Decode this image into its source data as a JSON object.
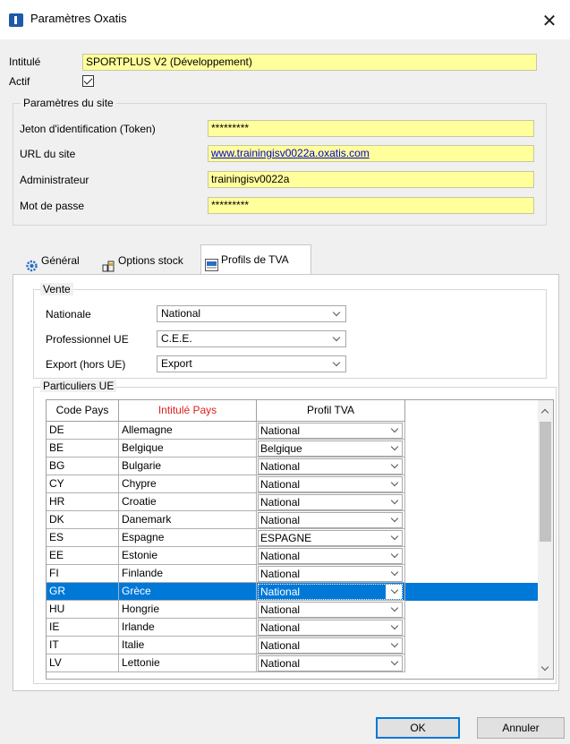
{
  "window": {
    "title": "Paramètres Oxatis",
    "close_glyph": "✕"
  },
  "form": {
    "intitule_label": "Intitulé",
    "intitule_value": "SPORTPLUS V2 (Développement)",
    "actif_label": "Actif",
    "actif_checked": true
  },
  "site": {
    "group_title": "Paramètres du site",
    "token_label": "Jeton d'identification (Token)",
    "token_value": "*********",
    "url_label": "URL du site",
    "url_value": "www.trainingisv0022a.oxatis.com",
    "admin_label": "Administrateur",
    "admin_value": "trainingisv0022a",
    "password_label": "Mot de passe",
    "password_value": "*********"
  },
  "tabs": [
    {
      "label": "Général",
      "icon": "gear-icon"
    },
    {
      "label": "Options stock",
      "icon": "stock-icon"
    },
    {
      "label": "Profils de TVA",
      "icon": "tva-icon",
      "active": true
    }
  ],
  "vente": {
    "group_title": "Vente",
    "nationale_label": "Nationale",
    "nationale_value": "National",
    "pro_ue_label": "Professionnel UE",
    "pro_ue_value": "C.E.E.",
    "export_label": "Export (hors UE)",
    "export_value": "Export"
  },
  "particuliers": {
    "group_title": "Particuliers UE",
    "columns": [
      "Code Pays",
      "Intitulé Pays",
      "Profil TVA"
    ],
    "rows": [
      {
        "code": "DE",
        "pays": "Allemagne",
        "profil": "National"
      },
      {
        "code": "BE",
        "pays": "Belgique",
        "profil": "Belgique"
      },
      {
        "code": "BG",
        "pays": "Bulgarie",
        "profil": "National"
      },
      {
        "code": "CY",
        "pays": "Chypre",
        "profil": "National"
      },
      {
        "code": "HR",
        "pays": "Croatie",
        "profil": "National"
      },
      {
        "code": "DK",
        "pays": "Danemark",
        "profil": "National"
      },
      {
        "code": "ES",
        "pays": "Espagne",
        "profil": "ESPAGNE"
      },
      {
        "code": "EE",
        "pays": "Estonie",
        "profil": "National"
      },
      {
        "code": "FI",
        "pays": "Finlande",
        "profil": "National"
      },
      {
        "code": "GR",
        "pays": "Grèce",
        "profil": "National",
        "selected": true
      },
      {
        "code": "HU",
        "pays": "Hongrie",
        "profil": "National"
      },
      {
        "code": "IE",
        "pays": "Irlande",
        "profil": "National"
      },
      {
        "code": "IT",
        "pays": "Italie",
        "profil": "National"
      },
      {
        "code": "LV",
        "pays": "Lettonie",
        "profil": "National"
      }
    ]
  },
  "buttons": {
    "ok": "OK",
    "cancel": "Annuler"
  },
  "colors": {
    "field_yellow": "#ffff9c",
    "selection_blue": "#0078d7",
    "header_red": "#e02020"
  }
}
